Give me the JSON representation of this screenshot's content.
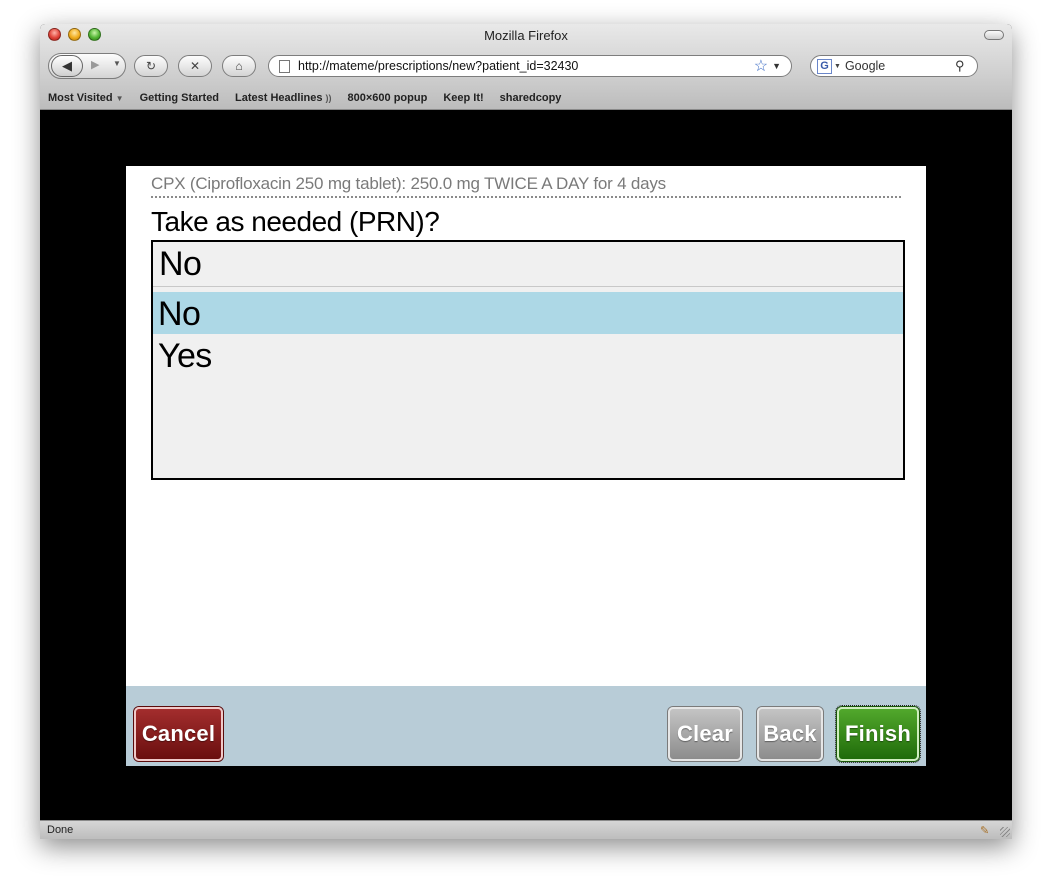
{
  "window": {
    "title": "Mozilla Firefox"
  },
  "toolbar": {
    "url": "http://mateme/prescriptions/new?patient_id=32430",
    "search_placeholder": "Google",
    "search_engine_letter": "G"
  },
  "bookmarks": [
    "Most Visited",
    "Getting Started",
    "Latest Headlines",
    "800×600 popup",
    "Keep It!",
    "sharedcopy"
  ],
  "page": {
    "prescription_summary": "CPX (Ciprofloxacin 250 mg tablet): 250.0 mg TWICE A DAY for 4 days",
    "question": "Take as needed (PRN)?",
    "selected_value": "No",
    "options": [
      {
        "label": "No",
        "selected": true
      },
      {
        "label": "Yes",
        "selected": false
      }
    ]
  },
  "buttons": {
    "cancel": "Cancel",
    "clear": "Clear",
    "back": "Back",
    "finish": "Finish"
  },
  "status": {
    "text": "Done"
  },
  "colors": {
    "selected_option": "#add8e6",
    "footer": "#b8ccd7",
    "cancel": "#8b1a1a",
    "finish": "#2f8a14",
    "neutral_button": "#a8a8a8"
  },
  "icons": {
    "back": "back-arrow-icon",
    "forward": "forward-arrow-icon",
    "reload": "reload-icon",
    "stop": "stop-icon",
    "home": "home-icon",
    "bookmark_star": "star-icon",
    "search": "magnifier-icon",
    "rss": "rss-icon"
  }
}
